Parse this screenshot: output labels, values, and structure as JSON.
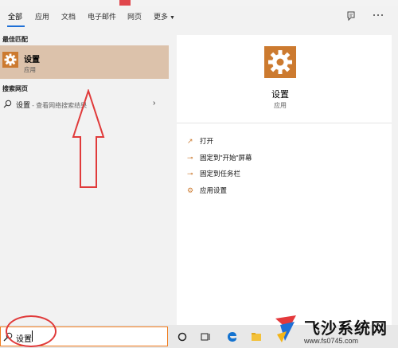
{
  "nav": {
    "tabs": [
      {
        "label": "全部"
      },
      {
        "label": "应用"
      },
      {
        "label": "文档"
      },
      {
        "label": "电子邮件"
      },
      {
        "label": "网页"
      },
      {
        "label": "更多"
      }
    ],
    "feedback_icon": "feedback-icon",
    "more_options_icon": "ellipsis-icon"
  },
  "best_match": {
    "section_label": "最佳匹配",
    "title": "设置",
    "subtitle": "应用",
    "icon": "gear-icon"
  },
  "search_web": {
    "section_label": "搜索网页",
    "query": "设置",
    "hint": " - 查看网络搜索结果",
    "icon": "search-icon"
  },
  "preview": {
    "title": "设置",
    "subtitle": "应用",
    "icon": "gear-icon",
    "actions": [
      {
        "label": "打开",
        "icon": "open-icon"
      },
      {
        "label": "固定到\"开始\"屏幕",
        "icon": "pin-icon"
      },
      {
        "label": "固定到任务栏",
        "icon": "pin-icon"
      },
      {
        "label": "应用设置",
        "icon": "gear-icon"
      }
    ]
  },
  "taskbar": {
    "search_value": "设置",
    "icons": [
      "cortana-icon",
      "task-view-icon",
      "edge-icon",
      "file-explorer-icon"
    ]
  },
  "colors": {
    "accent": "#cc7a2f",
    "selected_row": "#dcc2ab",
    "search_border": "#f07b1d",
    "annotation_red": "#e03a3a",
    "tab_underline": "#1e6fd6"
  },
  "watermark": {
    "name": "飞沙系统网",
    "url": "www.fs0745.com"
  }
}
